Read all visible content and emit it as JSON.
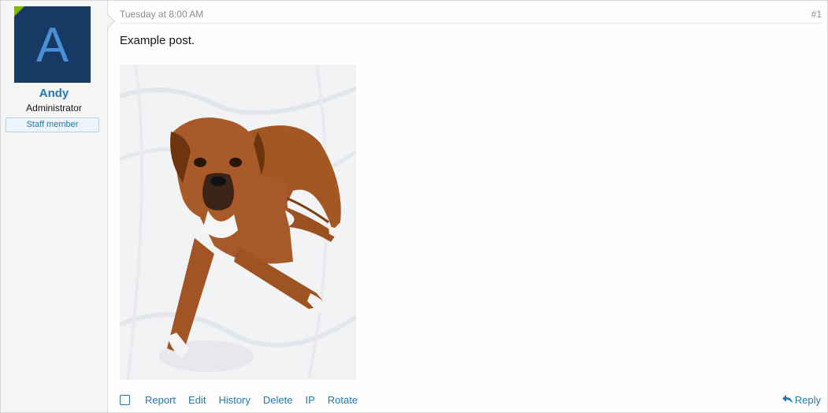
{
  "user": {
    "avatar_letter": "A",
    "name": "Andy",
    "title": "Administrator",
    "badge": "Staff member",
    "avatar_color": "#163a63",
    "online_color": "#7fb900"
  },
  "post": {
    "date": "Tuesday at 8:00 AM",
    "number": "#1",
    "message": "Example post."
  },
  "actions": {
    "items": [
      "Report",
      "Edit",
      "History",
      "Delete",
      "IP",
      "Rotate"
    ],
    "reply": "Reply"
  },
  "theme": {
    "link_color": "#2577b1",
    "muted_color": "#8c8c8c"
  }
}
